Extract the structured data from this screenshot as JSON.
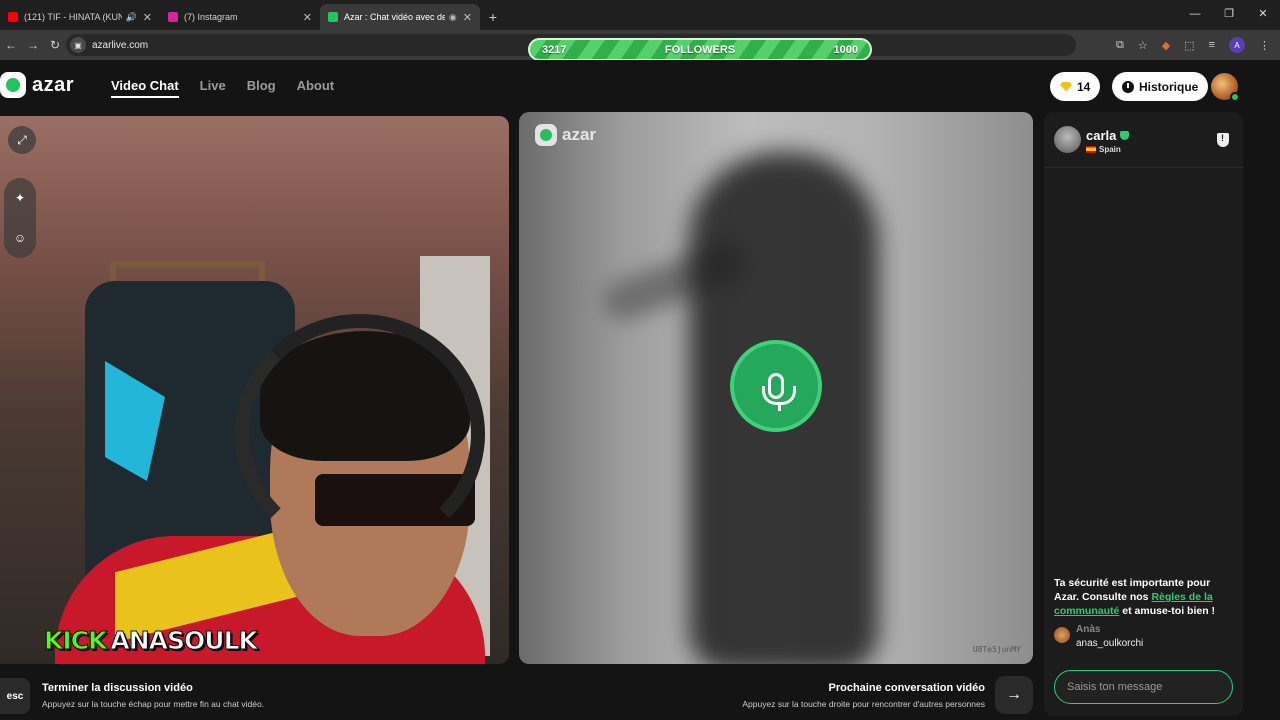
{
  "browser": {
    "tabs": [
      {
        "title": "(121) TIF - HINATA (KUNDA",
        "favicon_color": "#ff0000"
      },
      {
        "title": "(7) Instagram",
        "favicon_color": "#d6249f"
      },
      {
        "title": "Azar : Chat vidéo avec de n",
        "favicon_color": "#22c55e"
      }
    ],
    "new_tab": "+",
    "url": "azarlive.com",
    "profile_initial": "A"
  },
  "overlay": {
    "followers_current": "3217",
    "followers_label": "FOLLOWERS",
    "followers_goal": "1000"
  },
  "site": {
    "logo_text": "azar",
    "nav": [
      "Video Chat",
      "Live",
      "Blog",
      "About"
    ],
    "gems": "14",
    "history_label": "Historique"
  },
  "self_video": {
    "stream_tag_kick": "KICK",
    "stream_tag_name": "ANASOULK"
  },
  "peer_video": {
    "logo_text": "azar",
    "peer_id": "U8Te5junMY"
  },
  "chat": {
    "peer_name": "carla",
    "peer_country": "Spain",
    "safety_prefix": "Ta sécurité est importante pour Azar. Consulte nos ",
    "safety_link": "Règles de la communauté",
    "safety_suffix": " et amuse-toi bien !",
    "message_author": "Anàs",
    "message_text": "anas_oulkorchi",
    "input_placeholder": "Saisis ton message"
  },
  "footer": {
    "esc_key": "esc",
    "end_title": "Terminer la discussion vidéo",
    "end_subtitle": "Appuyez sur la touche échap pour mettre fin au chat vidéo.",
    "next_title": "Prochaine conversation vidéo",
    "next_subtitle": "Appuyez sur la touche droite pour rencontrer d'autres personnes",
    "next_arrow": "→"
  },
  "colors": {
    "accent": "#22c55e",
    "background": "#141414"
  }
}
